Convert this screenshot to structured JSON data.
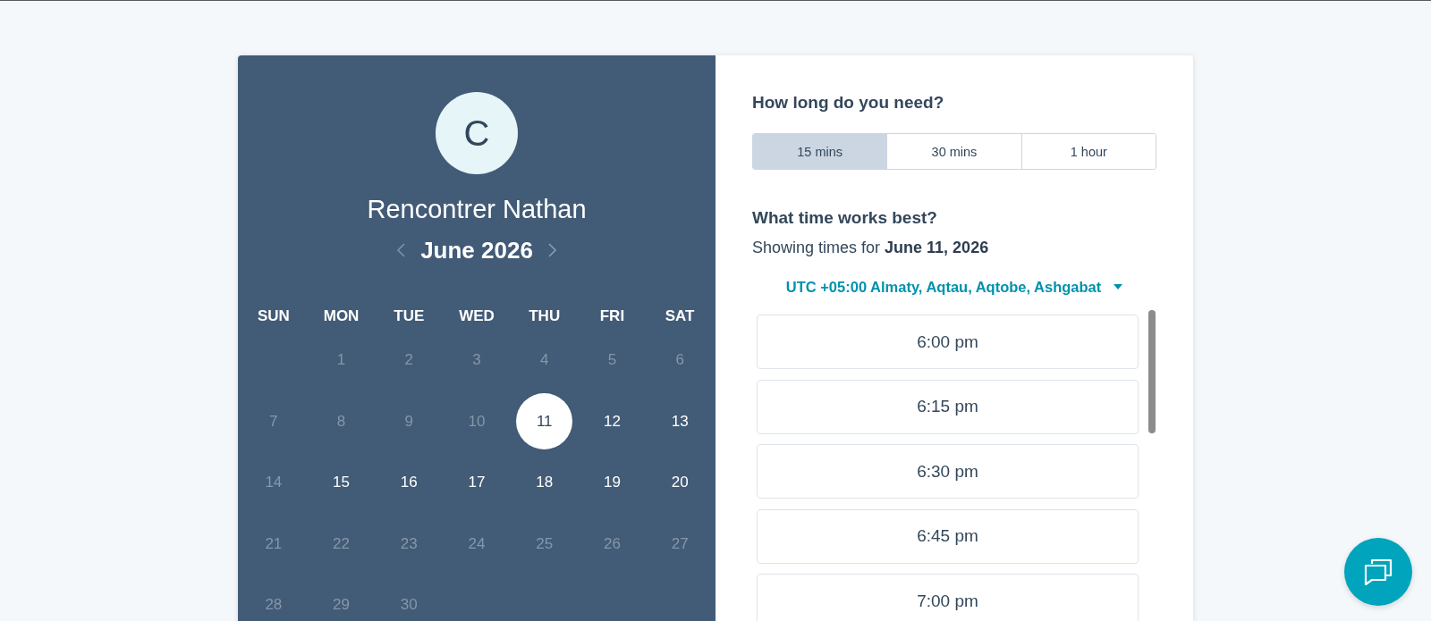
{
  "organizer": {
    "initial": "C",
    "title": "Rencontrer Nathan"
  },
  "calendar": {
    "month": "June 2026",
    "weekdays": [
      "SUN",
      "MON",
      "TUE",
      "WED",
      "THU",
      "FRI",
      "SAT"
    ],
    "weeks": [
      {
        "days": [
          {
            "label": "1",
            "disabled": true,
            "selected": false
          },
          {
            "label": "2",
            "disabled": true,
            "selected": false
          },
          {
            "label": "3",
            "disabled": true,
            "selected": false
          },
          {
            "label": "4",
            "disabled": true,
            "selected": false
          },
          {
            "label": "5",
            "disabled": true,
            "selected": false
          },
          {
            "label": "6",
            "disabled": true,
            "selected": false
          }
        ]
      },
      {
        "days": [
          {
            "label": "7",
            "disabled": true,
            "selected": false
          },
          {
            "label": "8",
            "disabled": true,
            "selected": false
          },
          {
            "label": "9",
            "disabled": true,
            "selected": false
          },
          {
            "label": "10",
            "disabled": true,
            "selected": false
          },
          {
            "label": "11",
            "disabled": false,
            "selected": true
          },
          {
            "label": "12",
            "disabled": false,
            "selected": false
          },
          {
            "label": "13",
            "disabled": false,
            "selected": false
          }
        ]
      },
      {
        "days": [
          {
            "label": "14",
            "disabled": true,
            "selected": false
          },
          {
            "label": "15",
            "disabled": false,
            "selected": false
          },
          {
            "label": "16",
            "disabled": false,
            "selected": false
          },
          {
            "label": "17",
            "disabled": false,
            "selected": false
          },
          {
            "label": "18",
            "disabled": false,
            "selected": false
          },
          {
            "label": "19",
            "disabled": false,
            "selected": false
          },
          {
            "label": "20",
            "disabled": false,
            "selected": false
          }
        ]
      },
      {
        "days": [
          {
            "label": "21",
            "disabled": true,
            "selected": false
          },
          {
            "label": "22",
            "disabled": true,
            "selected": false
          },
          {
            "label": "23",
            "disabled": true,
            "selected": false
          },
          {
            "label": "24",
            "disabled": true,
            "selected": false
          },
          {
            "label": "25",
            "disabled": true,
            "selected": false
          },
          {
            "label": "26",
            "disabled": true,
            "selected": false
          },
          {
            "label": "27",
            "disabled": true,
            "selected": false
          }
        ]
      },
      {
        "days": [
          {
            "label": "28",
            "disabled": true,
            "selected": false
          },
          {
            "label": "29",
            "disabled": true,
            "selected": false
          },
          {
            "label": "30",
            "disabled": true,
            "selected": false
          }
        ]
      }
    ]
  },
  "duration": {
    "heading": "How long do you need?",
    "options": [
      {
        "label": "15 mins",
        "selected": true
      },
      {
        "label": "30 mins",
        "selected": false
      },
      {
        "label": "1 hour",
        "selected": false
      }
    ]
  },
  "times": {
    "heading": "What time works best?",
    "date_caption": "Showing times for **June 11, 2026**",
    "timezone": "UTC +05:00 Almaty, Aqtau, Aqtobe, Ashgabat",
    "slots": [
      "6:00 pm",
      "6:15 pm",
      "6:30 pm",
      "6:45 pm",
      "7:00 pm"
    ]
  }
}
